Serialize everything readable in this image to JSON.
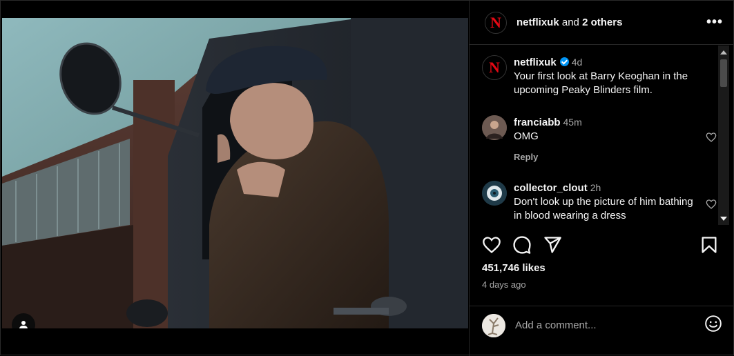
{
  "post": {
    "image_alt": "Barry Keoghan in a flat cap leaning out of a vintage car window",
    "tag_icon": "user-icon"
  },
  "header": {
    "username": "netflixuk",
    "connector": " and ",
    "others": "2 others",
    "more": "•••"
  },
  "caption": {
    "username": "netflixuk",
    "time": "4d",
    "text": "Your first look at Barry Keoghan in the upcoming Peaky Blinders film."
  },
  "comments": [
    {
      "username": "franciabb",
      "time": "45m",
      "text": "OMG",
      "reply": "Reply"
    },
    {
      "username": "collector_clout",
      "time": "2h",
      "text": "Don't look up the picture of him bathing in blood wearing a dress"
    }
  ],
  "stats": {
    "likes": "451,746 likes",
    "ago": "4 days ago"
  },
  "composer": {
    "placeholder": "Add a comment..."
  },
  "colors": {
    "netflix_red": "#e50914",
    "verified_blue": "#0095f6",
    "muted_text": "#a8a8a8"
  }
}
